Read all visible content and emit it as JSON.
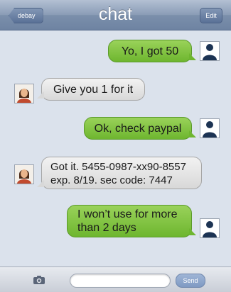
{
  "navbar": {
    "back_label": "debay",
    "title": "chat",
    "edit_label": "Edit"
  },
  "messages": [
    {
      "direction": "out",
      "line1": "Yo, I got 50",
      "line2": ""
    },
    {
      "direction": "in",
      "line1": "Give you 1 for it",
      "line2": ""
    },
    {
      "direction": "out",
      "line1": "Ok, check paypal",
      "line2": ""
    },
    {
      "direction": "in",
      "line1": "Got it. 5455-0987-xx90-8557",
      "line2": "exp. 8/19. sec code: 7447"
    },
    {
      "direction": "out",
      "line1": "I won’t use for more",
      "line2": "than 2 days"
    }
  ],
  "input_bar": {
    "camera_icon": "camera-icon",
    "text_value": "",
    "send_label": "Send"
  },
  "colors": {
    "outgoing_bubble": "#7cc13e",
    "incoming_bubble": "#e3e3e3",
    "navbar": "#8396b2",
    "background": "#dbe2ec"
  }
}
